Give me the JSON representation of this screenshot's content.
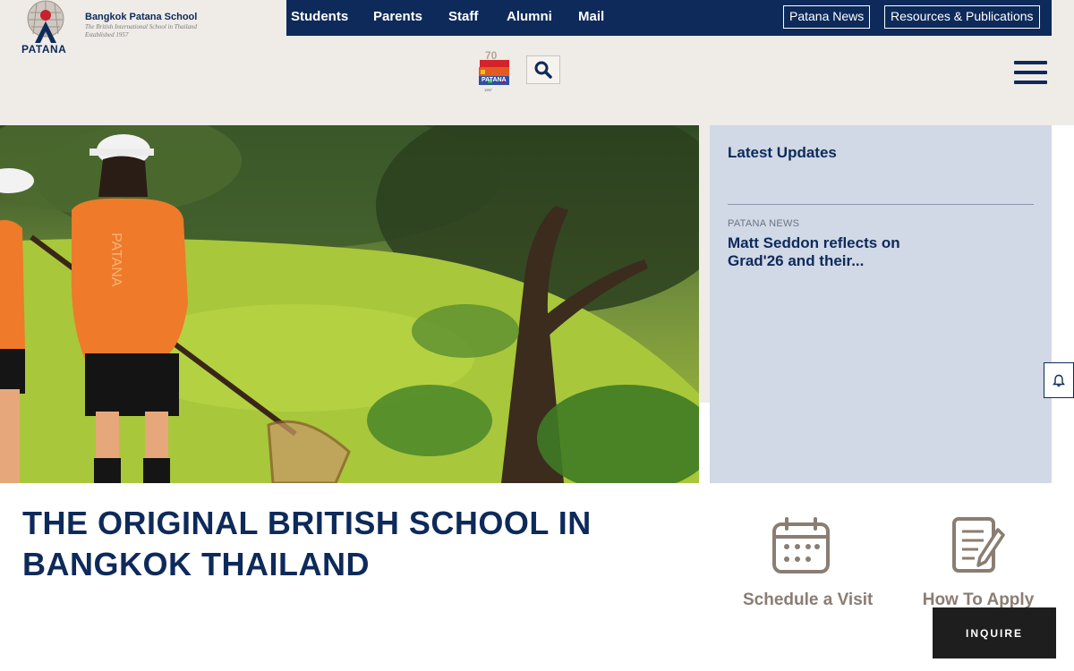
{
  "brand": {
    "logo_word": "PATANA",
    "school_name": "Bangkok Patana School",
    "tagline_line1": "The British International School in Thailand",
    "tagline_line2": "Established 1957"
  },
  "topnav": {
    "links": [
      "Students",
      "Parents",
      "Staff",
      "Alumni",
      "Mail"
    ],
    "boxed": [
      "Patana News",
      "Resources & Publications"
    ]
  },
  "icons": {
    "search": "search-icon",
    "menu": "hamburger-menu-icon",
    "bell": "bell-icon",
    "calendar": "calendar-icon",
    "form": "application-form-icon",
    "badge": "70th-anniversary-badge"
  },
  "updates": {
    "title": "Latest Updates",
    "items": [
      {
        "category": "PATANA NEWS",
        "title": "Matt Seddon reflects on Grad'26 and their..."
      }
    ]
  },
  "headline": {
    "bold_part": "THE ORIGINAL BRITISH SCHOOL",
    "normal_part": " IN BANGKOK THAILAND"
  },
  "quicklinks": [
    {
      "label": "Schedule a Visit"
    },
    {
      "label": "How To Apply"
    }
  ],
  "inquire": {
    "label": "INQUIRE"
  },
  "colors": {
    "navy": "#0d2a5a",
    "beige": "#efebe7",
    "panel": "#d1d8e6",
    "icon_brown": "#8a7d72"
  }
}
